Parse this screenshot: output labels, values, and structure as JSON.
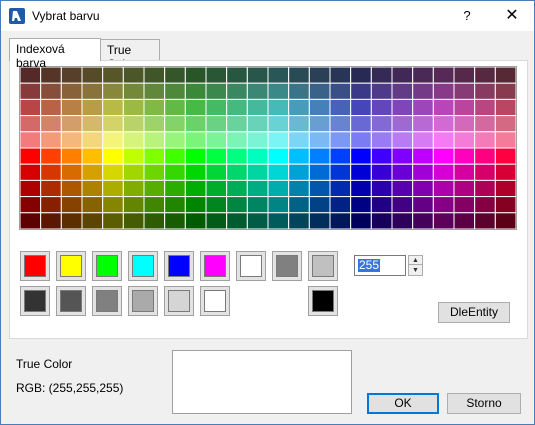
{
  "window": {
    "title": "Vybrat barvu",
    "help_label": "?",
    "close_label": "✕"
  },
  "tabs": [
    {
      "label": "Indexová barva",
      "active": true
    },
    {
      "label": "True Color",
      "active": false
    }
  ],
  "palette": {
    "columns": 24,
    "rows": 10
  },
  "swatches_row1": [
    {
      "color": "#ff0000",
      "name": "red"
    },
    {
      "color": "#ffff00",
      "name": "yellow"
    },
    {
      "color": "#00ff00",
      "name": "green"
    },
    {
      "color": "#00ffff",
      "name": "cyan"
    },
    {
      "color": "#0000ff",
      "name": "blue"
    },
    {
      "color": "#ff00ff",
      "name": "magenta"
    },
    {
      "color": "#ffffff",
      "name": "white"
    },
    {
      "color": "#808080",
      "name": "gray"
    },
    {
      "color": "#c0c0c0",
      "name": "light-gray"
    }
  ],
  "swatches_row2": [
    {
      "color": "#333333",
      "name": "gray-1"
    },
    {
      "color": "#555555",
      "name": "gray-2"
    },
    {
      "color": "#808080",
      "name": "gray-3"
    },
    {
      "color": "#aaaaaa",
      "name": "gray-4"
    },
    {
      "color": "#d5d5d5",
      "name": "gray-5"
    },
    {
      "color": "#ffffff",
      "name": "gray-6"
    },
    {
      "color": "#000000",
      "name": "black"
    }
  ],
  "index_value": "255",
  "buttons": {
    "dle_entity": "DleEntity",
    "ok": "OK",
    "cancel": "Storno"
  },
  "info": {
    "true_color_label": "True Color",
    "rgb_label": "RGB: (255,255,255)",
    "preview_color": "#ffffff"
  }
}
